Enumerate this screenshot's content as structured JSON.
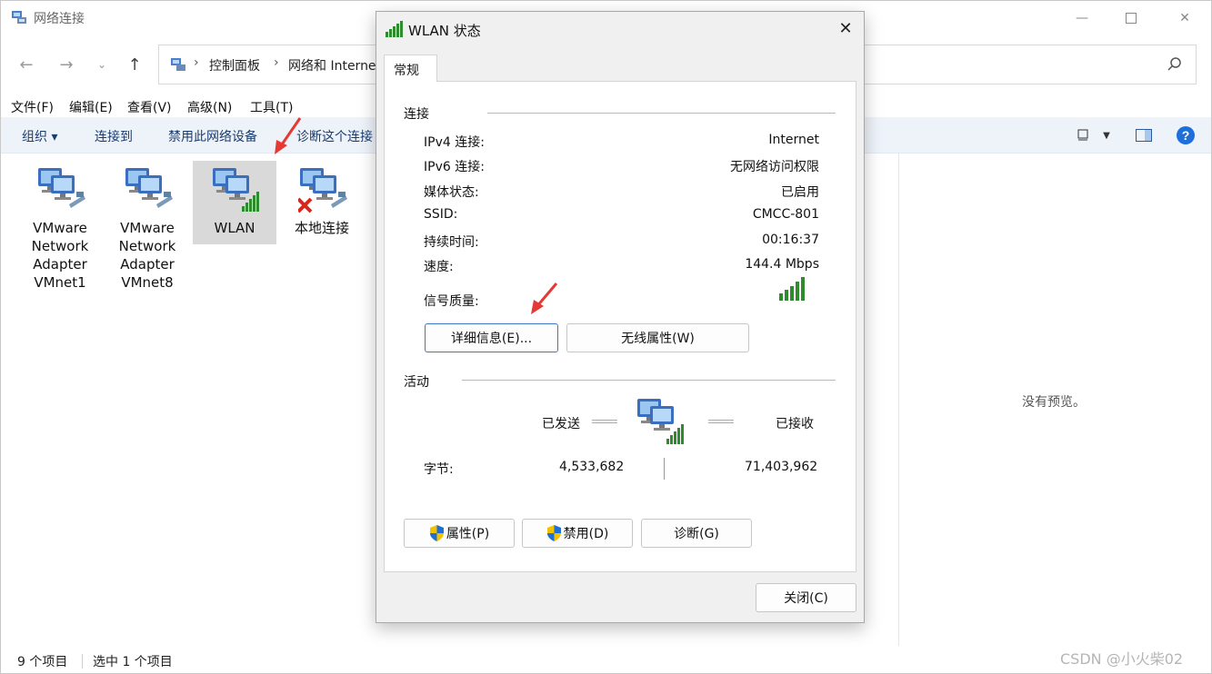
{
  "explorer": {
    "title": "网络连接",
    "breadcrumb": [
      "控制面板",
      "网络和 Interne"
    ],
    "menu": [
      "文件(F)",
      "编辑(E)",
      "查看(V)",
      "高级(N)",
      "工具(T)"
    ],
    "commands": {
      "organize": "组织 ▾",
      "connect_to": "连接到",
      "disable_device": "禁用此网络设备",
      "diagnose": "诊断这个连接"
    },
    "items": [
      {
        "label": "VMware Network Adapter VMnet1"
      },
      {
        "label": "VMware Network Adapter VMnet8"
      },
      {
        "label": "WLAN"
      },
      {
        "label": "本地连接"
      }
    ],
    "preview_text": "没有预览。",
    "status": {
      "item_count": "9 个项目",
      "selected": "选中 1 个项目"
    }
  },
  "watermark": "CSDN @小火柴02",
  "dialog": {
    "title": "WLAN 状态",
    "tab": "常规",
    "connection_group": "连接",
    "rows": [
      {
        "key": "IPv4 连接:",
        "value": "Internet"
      },
      {
        "key": "IPv6 连接:",
        "value": "无网络访问权限"
      },
      {
        "key": "媒体状态:",
        "value": "已启用"
      },
      {
        "key": "SSID:",
        "value": "CMCC-801"
      },
      {
        "key": "持续时间:",
        "value": "00:16:37"
      },
      {
        "key": "速度:",
        "value": "144.4 Mbps"
      }
    ],
    "signal_label": "信号质量:",
    "signal_bars": 5,
    "details_button": "详细信息(E)...",
    "wireless_props_button": "无线属性(W)",
    "activity_group": "活动",
    "sent_label": "已发送",
    "received_label": "已接收",
    "bytes_label": "字节:",
    "bytes_sent": "4,533,682",
    "bytes_received": "71,403,962",
    "properties_button": "属性(P)",
    "disable_button": "禁用(D)",
    "diagnose_button": "诊断(G)",
    "close_button": "关闭(C)"
  },
  "colors": {
    "accent": "#0a64d6",
    "signal_green": "#2e8b2e",
    "selection": "#d9d9d9",
    "command_bar": "#eef3fa",
    "arrow_red": "#e53935"
  }
}
